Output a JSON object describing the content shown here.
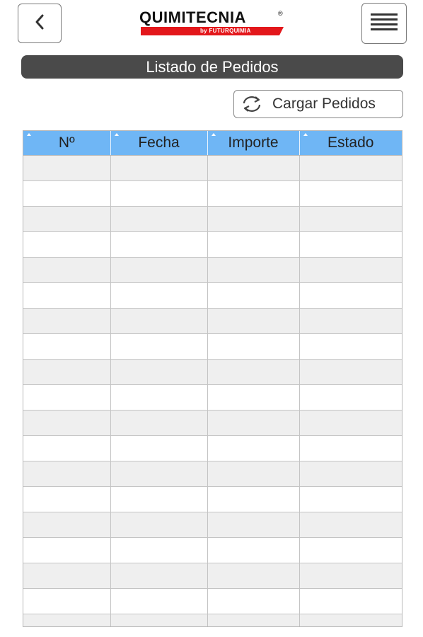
{
  "header": {
    "back_icon": "chevron-left-icon",
    "menu_icon": "hamburger-menu-icon",
    "logo": {
      "brand": "QUIMITECNIA",
      "registered": "®",
      "sub": "by FUTURQUIMIA",
      "bar_color": "#e3171b"
    }
  },
  "page": {
    "title": "Listado de Pedidos"
  },
  "actions": {
    "load_label": "Cargar Pedidos",
    "load_icon": "refresh-icon"
  },
  "table": {
    "columns": [
      "Nº",
      "Fecha",
      "Importe",
      "Estado"
    ],
    "header_color": "#6fb6f5",
    "row_count": 19,
    "rows": []
  }
}
